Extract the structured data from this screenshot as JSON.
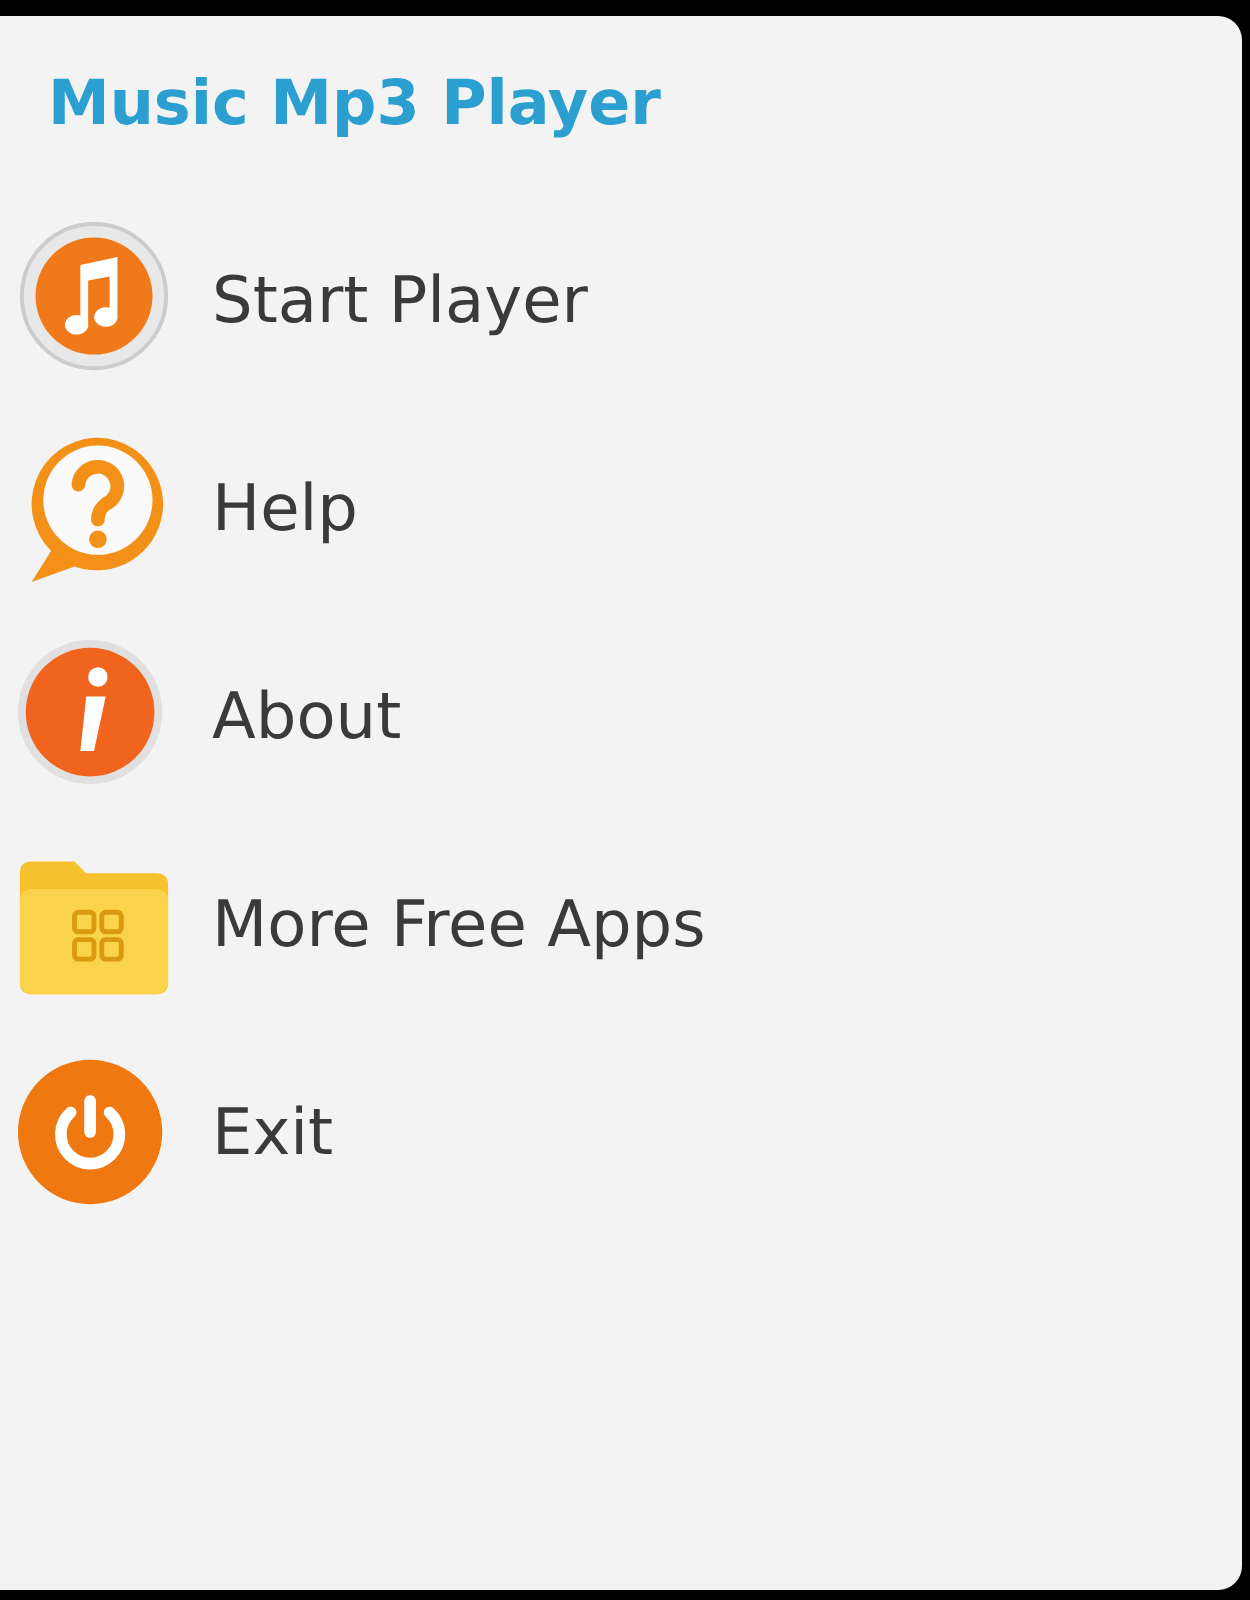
{
  "title": "Music Mp3 Player",
  "menu": [
    {
      "label": "Start Player",
      "kind": "music"
    },
    {
      "label": "Help",
      "kind": "help"
    },
    {
      "label": "About",
      "kind": "info"
    },
    {
      "label": "More Free Apps",
      "kind": "apps"
    },
    {
      "label": "Exit",
      "kind": "power"
    }
  ]
}
